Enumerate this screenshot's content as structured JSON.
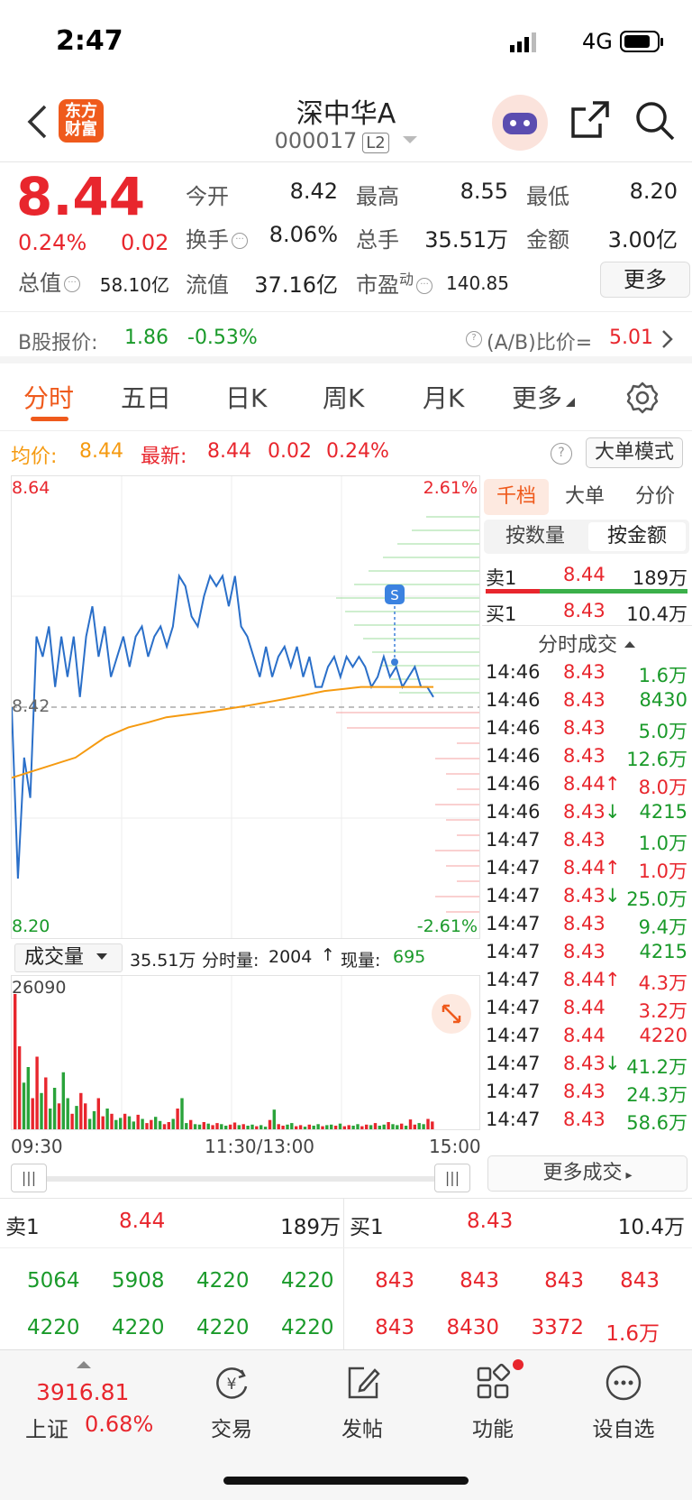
{
  "status_bar": {
    "time": "2:47",
    "network": "4G"
  },
  "header": {
    "logo_line1": "东方",
    "logo_line2": "财富",
    "stock_name": "深中华A",
    "stock_code": "000017",
    "level": "L2"
  },
  "quote": {
    "price": "8.44",
    "change_pct": "0.24%",
    "change": "0.02",
    "fields": [
      {
        "label": "今开",
        "value": "8.42",
        "color": "#222222"
      },
      {
        "label": "最高",
        "value": "8.55",
        "color": "#e8262d"
      },
      {
        "label": "最低",
        "value": "8.20",
        "color": "#1a9a2a"
      },
      {
        "label": "换手",
        "value": "8.06%",
        "color": "#222222"
      },
      {
        "label": "总手",
        "value": "35.51万",
        "color": "#222222"
      },
      {
        "label": "金额",
        "value": "3.00亿",
        "color": "#222222"
      },
      {
        "label": "总值",
        "value": "58.10亿",
        "color": "#222222"
      },
      {
        "label": "流值",
        "value": "37.16亿",
        "color": "#222222"
      },
      {
        "label": "市盈",
        "value": "140.85",
        "color": "#222222",
        "superscript": "动"
      }
    ],
    "more_label": "更多"
  },
  "b_share": {
    "label": "B股报价:",
    "price": "1.86",
    "change": "-0.53%",
    "ratio_label": "(A/B)比价=",
    "ratio_value": "5.01"
  },
  "tabs": [
    "分时",
    "五日",
    "日K",
    "周K",
    "月K",
    "更多"
  ],
  "avg_line": {
    "avg_label": "均价:",
    "avg_value": "8.44",
    "latest_label": "最新:",
    "latest_value": "8.44",
    "change": "0.02",
    "change_pct": "0.24%",
    "big_order_label": "大单模式"
  },
  "chart_data": {
    "type": "line",
    "title": "",
    "y_labels": {
      "top": "8.64",
      "mid": "8.42",
      "bottom": "8.20",
      "top_pct": "2.61%",
      "bottom_pct": "-2.61%"
    },
    "ylim": [
      8.2,
      8.64
    ],
    "prev_close": 8.42,
    "x_labels": [
      "09:30",
      "11:30/13:00",
      "15:00"
    ],
    "series": [
      {
        "name": "",
        "color": "#2a6fc9",
        "values": [
          8.42,
          8.25,
          8.37,
          8.33,
          8.49,
          8.47,
          8.5,
          8.44,
          8.49,
          8.45,
          8.49,
          8.43,
          8.49,
          8.52,
          8.47,
          8.5,
          8.45,
          8.47,
          8.49,
          8.46,
          8.49,
          8.5,
          8.47,
          8.49,
          8.5,
          8.48,
          8.5,
          8.55,
          8.54,
          8.51,
          8.5,
          8.53,
          8.55,
          8.54,
          8.55,
          8.52,
          8.55,
          8.5,
          8.49,
          8.47,
          8.45,
          8.48,
          8.45,
          8.47,
          8.48,
          8.46,
          8.48,
          8.45,
          8.47,
          8.44,
          8.44,
          8.46,
          8.47,
          8.45,
          8.47,
          8.46,
          8.47,
          8.46,
          8.44,
          8.45,
          8.47,
          8.45,
          8.46,
          8.44,
          8.45,
          8.46,
          8.44,
          8.44,
          8.43
        ]
      },
      {
        "name": "",
        "color": "#f59a10",
        "values": [
          8.35,
          8.37,
          8.39,
          8.4,
          8.405,
          8.41,
          8.412,
          8.414,
          8.416,
          8.418,
          8.42,
          8.422,
          8.424,
          8.426,
          8.428,
          8.43,
          8.432,
          8.434,
          8.436,
          8.437,
          8.438,
          8.439,
          8.44,
          8.44,
          8.44,
          8.44,
          8.44,
          8.44,
          8.44,
          8.44,
          8.44,
          8.44
        ]
      }
    ],
    "markers": [
      {
        "label": "S"
      }
    ],
    "volume": {
      "max_label": "26090",
      "values": [
        26090,
        16000,
        9000,
        12000,
        6000,
        14000,
        7000,
        10000,
        4000,
        8000,
        5000,
        11000,
        6000,
        3000,
        4500,
        7000,
        5000,
        2000,
        3500,
        6000,
        2500,
        4000,
        3000,
        1800,
        2200,
        3000,
        2500,
        1500,
        2800,
        2000,
        1200,
        1800,
        2400,
        1600,
        1000,
        1400,
        2000,
        4000,
        6000,
        1200,
        1800,
        1000,
        900,
        1400,
        1100,
        800,
        1200,
        1000,
        700,
        900,
        1300,
        800,
        1000,
        700,
        900,
        600,
        800,
        500,
        1800,
        3800,
        1000,
        700,
        900,
        1200,
        600,
        800,
        500,
        900,
        700,
        1000,
        600,
        800,
        900,
        700,
        1100,
        600,
        800,
        700,
        1000,
        600,
        900,
        800,
        1200,
        700,
        900,
        1400,
        1000,
        800,
        1100,
        700,
        1900,
        900,
        1200,
        1000,
        2000,
        1500
      ]
    }
  },
  "volume_header": {
    "select_label": "成交量",
    "total": "35.51万",
    "interval_label": "分时量:",
    "interval_value": "2004",
    "now_label": "现量:",
    "now_value": "695"
  },
  "right_panel": {
    "tabs": [
      "千档",
      "大单",
      "分价"
    ],
    "subtabs": [
      "按数量",
      "按金额"
    ],
    "ask1": {
      "label": "卖1",
      "price": "8.44",
      "amount": "189万"
    },
    "bid1": {
      "label": "买1",
      "price": "8.43",
      "amount": "10.4万"
    },
    "ticks_title": "分时成交",
    "ticks": [
      {
        "time": "14:46",
        "price": "8.43",
        "arrow": "",
        "vol": "1.6万",
        "vcolor": "#1a9a2a"
      },
      {
        "time": "14:46",
        "price": "8.43",
        "arrow": "",
        "vol": "8430",
        "vcolor": "#1a9a2a"
      },
      {
        "time": "14:46",
        "price": "8.43",
        "arrow": "",
        "vol": "5.0万",
        "vcolor": "#1a9a2a"
      },
      {
        "time": "14:46",
        "price": "8.43",
        "arrow": "",
        "vol": "12.6万",
        "vcolor": "#1a9a2a"
      },
      {
        "time": "14:46",
        "price": "8.44",
        "arrow": "↑",
        "vol": "8.0万",
        "vcolor": "#e8262d"
      },
      {
        "time": "14:46",
        "price": "8.43",
        "arrow": "↓",
        "vol": "4215",
        "vcolor": "#1a9a2a"
      },
      {
        "time": "14:47",
        "price": "8.43",
        "arrow": "",
        "vol": "1.0万",
        "vcolor": "#1a9a2a"
      },
      {
        "time": "14:47",
        "price": "8.44",
        "arrow": "↑",
        "vol": "1.0万",
        "vcolor": "#e8262d"
      },
      {
        "time": "14:47",
        "price": "8.43",
        "arrow": "↓",
        "vol": "25.0万",
        "vcolor": "#1a9a2a"
      },
      {
        "time": "14:47",
        "price": "8.43",
        "arrow": "",
        "vol": "9.4万",
        "vcolor": "#1a9a2a"
      },
      {
        "time": "14:47",
        "price": "8.43",
        "arrow": "",
        "vol": "4215",
        "vcolor": "#1a9a2a"
      },
      {
        "time": "14:47",
        "price": "8.44",
        "arrow": "↑",
        "vol": "4.3万",
        "vcolor": "#e8262d"
      },
      {
        "time": "14:47",
        "price": "8.44",
        "arrow": "",
        "vol": "3.2万",
        "vcolor": "#e8262d"
      },
      {
        "time": "14:47",
        "price": "8.44",
        "arrow": "",
        "vol": "4220",
        "vcolor": "#e8262d"
      },
      {
        "time": "14:47",
        "price": "8.43",
        "arrow": "↓",
        "vol": "41.2万",
        "vcolor": "#1a9a2a"
      },
      {
        "time": "14:47",
        "price": "8.43",
        "arrow": "",
        "vol": "24.3万",
        "vcolor": "#1a9a2a"
      },
      {
        "time": "14:47",
        "price": "8.43",
        "arrow": "",
        "vol": "58.6万",
        "vcolor": "#1a9a2a"
      }
    ],
    "more_ticks_label": "更多成交"
  },
  "order_book": {
    "ask": {
      "label": "卖1",
      "price": "8.44",
      "amount": "189万",
      "orders": [
        "5064",
        "5908",
        "4220",
        "4220",
        "4220",
        "4220",
        "4220",
        "4220"
      ]
    },
    "bid": {
      "label": "买1",
      "price": "8.43",
      "amount": "10.4万",
      "orders": [
        "843",
        "843",
        "843",
        "843",
        "843",
        "8430",
        "3372",
        "1.6万"
      ]
    }
  },
  "bottom_nav": {
    "index_value": "3916.81",
    "index_name": "上证",
    "index_pct": "0.68%",
    "items": [
      {
        "label": "交易",
        "icon": "yuan-exchange-icon"
      },
      {
        "label": "发帖",
        "icon": "edit-post-icon"
      },
      {
        "label": "功能",
        "icon": "grid-apps-icon"
      },
      {
        "label": "设自选",
        "icon": "more-dots-icon"
      }
    ]
  }
}
